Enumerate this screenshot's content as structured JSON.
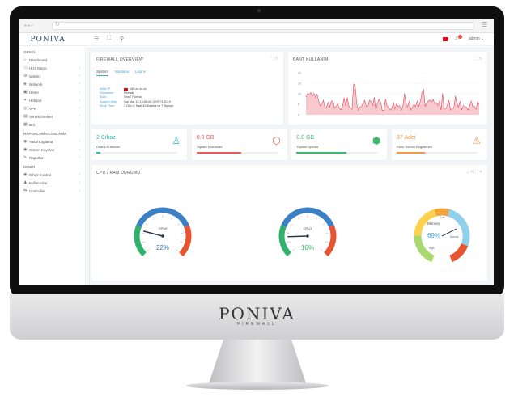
{
  "browser": {
    "dots": "●●●",
    "reload": "↻",
    "menu": "☰"
  },
  "header": {
    "logo": "PONIVA",
    "user": "admin ⌄"
  },
  "sidebar": {
    "sections": [
      {
        "title": "GENEL",
        "items": [
          {
            "icon": "⌂",
            "label": "Dashboard",
            "chevron": ""
          },
          {
            "icon": "▭",
            "label": "Hızlı Menü",
            "chevron": "›"
          },
          {
            "icon": "⚙",
            "label": "Sistem",
            "chevron": "›"
          },
          {
            "icon": "◈",
            "label": "Network",
            "chevron": "›"
          },
          {
            "icon": "▣",
            "label": "İzinler",
            "chevron": "›"
          },
          {
            "icon": "✦",
            "label": "Hotspot",
            "chevron": "›"
          },
          {
            "icon": "◎",
            "label": "VPN",
            "chevron": "›"
          },
          {
            "icon": "▤",
            "label": "Veri Hizmetleri",
            "chevron": "›"
          },
          {
            "icon": "▦",
            "label": "IDS",
            "chevron": "›"
          }
        ]
      },
      {
        "title": "RAPORLAMA/LOGLAMA",
        "items": [
          {
            "icon": "◉",
            "label": "Yasal Loglama",
            "chevron": "›"
          },
          {
            "icon": "◉",
            "label": "Sistem Kayıtları",
            "chevron": "›"
          },
          {
            "icon": "✎",
            "label": "Raporlar",
            "chevron": "›"
          }
        ]
      },
      {
        "title": "DİĞER",
        "items": [
          {
            "icon": "◉",
            "label": "Cihaz Kontrol",
            "chevron": "›"
          },
          {
            "icon": "♟",
            "label": "Kullanıcılar",
            "chevron": "›"
          },
          {
            "icon": "⇆",
            "label": "Controller",
            "chevron": "›"
          }
        ]
      }
    ]
  },
  "firewall": {
    "title": "FIREWALL OVERVIEW",
    "tabs": [
      "System",
      "Modules",
      "Lisans"
    ],
    "rows": [
      {
        "k": "WAN IP",
        "v": "185.xx.xx.xx"
      },
      {
        "k": "Hostname",
        "v": "Firewall"
      },
      {
        "k": "Build",
        "v": "Geo7 Poniva"
      },
      {
        "k": "System time",
        "v": "Sat Mar 15 10:56:00 GMT+3 2019"
      },
      {
        "k": "Work Time",
        "v": "3 Gün 0 Saat 40 Dakika ve 7 Saniye"
      }
    ]
  },
  "bandwidth": {
    "title": "BANT KULLANIMI",
    "yticks": [
      "20",
      "15",
      "10",
      "5",
      "0"
    ]
  },
  "stats": [
    {
      "value": "2 Cihaz",
      "label": "Lisans Kullanımı",
      "color": "#2ebfb4",
      "fill": 0.05,
      "icon": "♙"
    },
    {
      "value": "0.0 GB",
      "label": "Toplam Download",
      "color": "#e85a5a",
      "fill": 0.55,
      "icon": "⬡"
    },
    {
      "value": "0.0 GB",
      "label": "Toplam Upload",
      "color": "#3cba6e",
      "fill": 0.62,
      "icon": "⬢"
    },
    {
      "value": "37 Adet",
      "label": "Koku Sorucu Engellenen",
      "color": "#f2994a",
      "fill": 0.35,
      "icon": "⚠"
    }
  ],
  "cpu": {
    "title": "CPU / RAM DURUMU",
    "gauges": [
      {
        "name": "CPU0",
        "value": 22,
        "text": "22%",
        "color": "#3b7fc4"
      },
      {
        "name": "CPU1",
        "value": 16,
        "text": "16%",
        "color": "#2fb36a"
      }
    ],
    "memory": {
      "name": "Memory",
      "value": 69,
      "text": "69%",
      "labels": [
        "Low",
        "Normal",
        "High"
      ]
    }
  },
  "chin": {
    "brand": "PONIVA",
    "sub": "FIREWALL"
  },
  "colors": {
    "accent": "#4aa3df",
    "chart": "#e04b5e",
    "chart_fill": "#f8c9cf"
  }
}
